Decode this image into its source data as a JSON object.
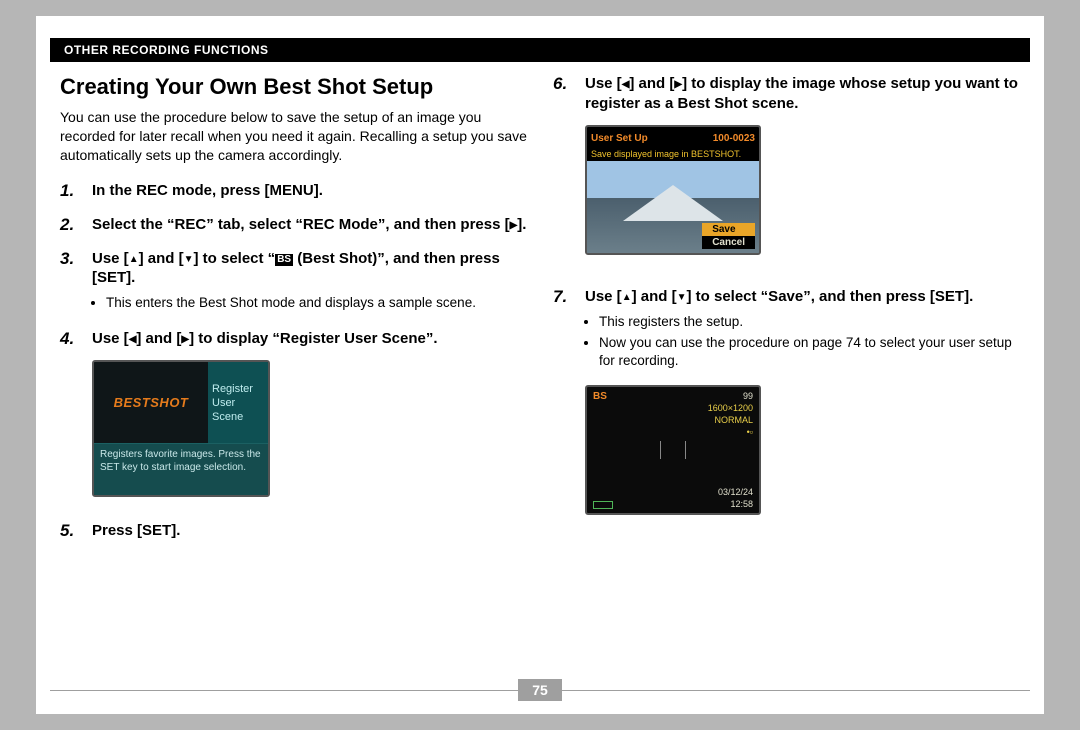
{
  "header": "OTHER RECORDING FUNCTIONS",
  "title": "Creating Your Own Best Shot Setup",
  "intro": "You can use the procedure below to save the setup of an image you recorded for later recall when you need it again. Recalling a setup you save automatically sets up the camera accordingly.",
  "steps_left": {
    "s1": {
      "num": "1.",
      "text": "In the REC mode, press [MENU]."
    },
    "s2": {
      "num": "2.",
      "text_a": "Select the “REC” tab, select “REC Mode”, and then press [",
      "text_b": "]."
    },
    "s3": {
      "num": "3.",
      "text_a": "Use [",
      "text_b": "] and [",
      "text_c": "] to select “",
      "bs": "BS",
      "text_d": " (Best Shot)”, and then press [SET].",
      "bullet": "This enters the Best Shot mode and displays a sample scene."
    },
    "s4": {
      "num": "4.",
      "text_a": "Use [",
      "text_b": "] and [",
      "text_c": "] to display “Register User Scene”."
    },
    "s5": {
      "num": "5.",
      "text": "Press [SET]."
    }
  },
  "steps_right": {
    "s6": {
      "num": "6.",
      "text_a": "Use [",
      "text_b": "] and [",
      "text_c": "] to display the image whose setup you want to register as a Best Shot scene."
    },
    "s7": {
      "num": "7.",
      "text_a": "Use [",
      "text_b": "] and [",
      "text_c": "] to select “Save”, and then press [SET].",
      "bullet1": "This registers the setup.",
      "bullet2": "Now you can use the procedure on page 74 to select your user setup for recording."
    }
  },
  "screenshots": {
    "ss1": {
      "brand": "BESTSHOT",
      "menu1": "Register",
      "menu2": "User",
      "menu3": "Scene",
      "desc": "Registers favorite images. Press the SET key to start image selection."
    },
    "ss2": {
      "hdr_l": "User Set Up",
      "hdr_r": "100-0023",
      "sub": "Save displayed image in BESTSHOT.",
      "save": "Save",
      "cancel": "Cancel"
    },
    "ss3": {
      "bs": "BS",
      "num": "99",
      "res": "1600×1200",
      "norm": "NORMAL",
      "card": "•▫",
      "date": "03/12/24",
      "time": "12:58"
    }
  },
  "page_number": "75"
}
